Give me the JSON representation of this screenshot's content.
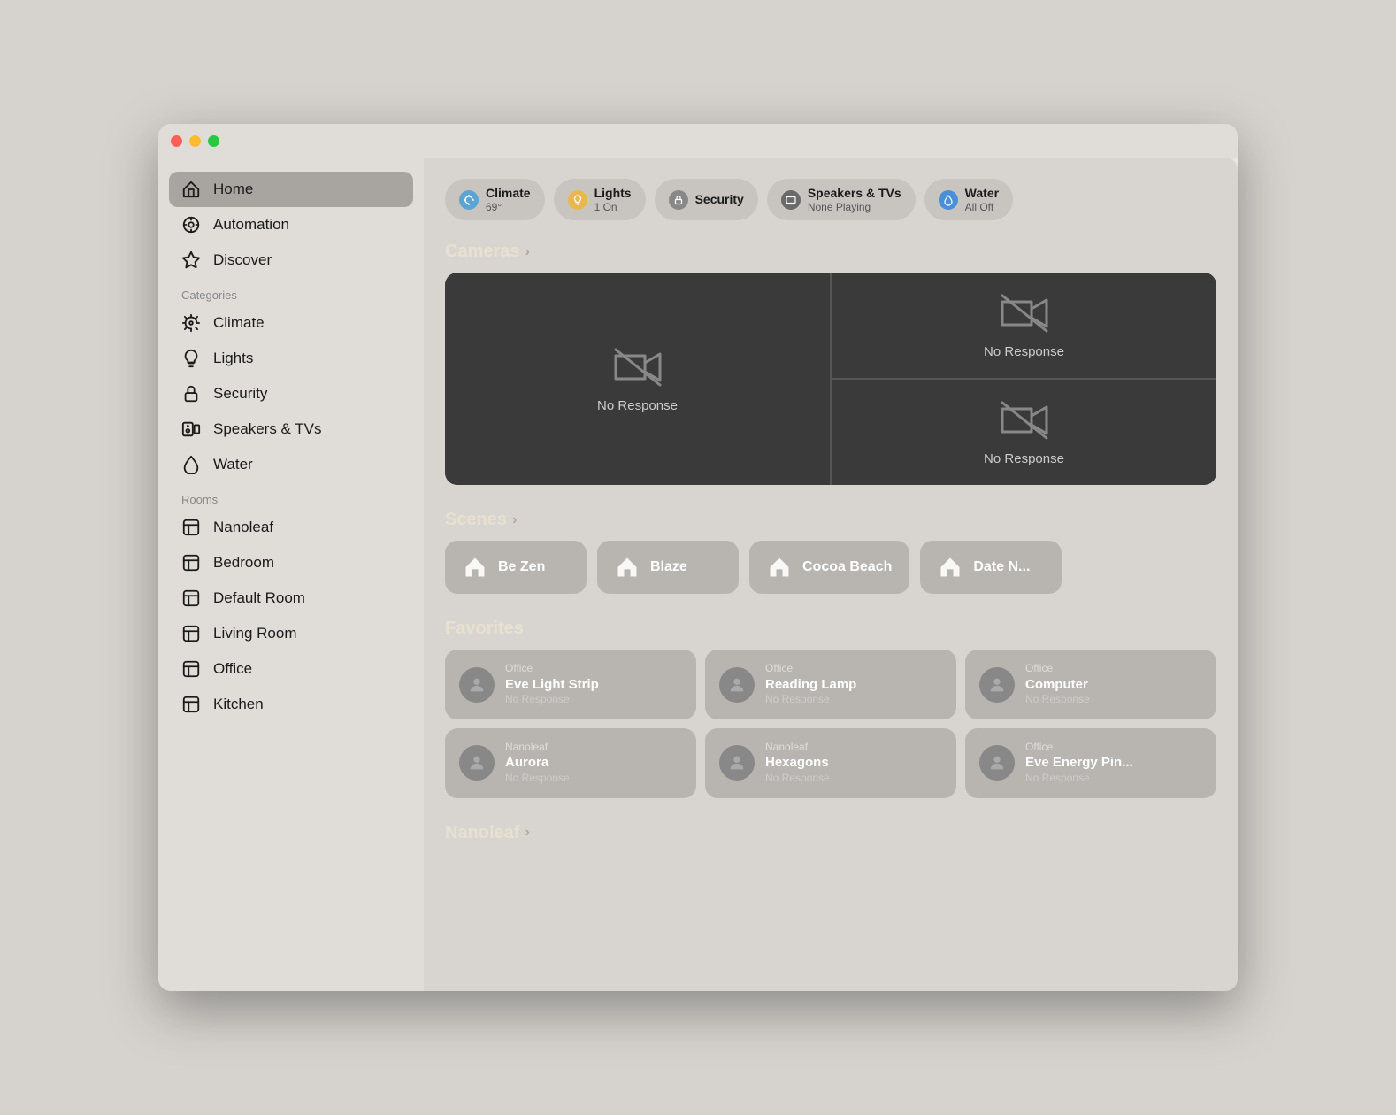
{
  "titlebar": {
    "buttons": [
      "close",
      "minimize",
      "maximize"
    ]
  },
  "sidebar": {
    "nav": [
      {
        "id": "home",
        "label": "Home",
        "icon": "home",
        "active": true
      },
      {
        "id": "automation",
        "label": "Automation",
        "icon": "automation",
        "active": false
      },
      {
        "id": "discover",
        "label": "Discover",
        "icon": "discover",
        "active": false
      }
    ],
    "categories_label": "Categories",
    "categories": [
      {
        "id": "climate",
        "label": "Climate",
        "icon": "climate"
      },
      {
        "id": "lights",
        "label": "Lights",
        "icon": "lights"
      },
      {
        "id": "security",
        "label": "Security",
        "icon": "security"
      },
      {
        "id": "speakers_tvs",
        "label": "Speakers & TVs",
        "icon": "speakers"
      },
      {
        "id": "water",
        "label": "Water",
        "icon": "water"
      }
    ],
    "rooms_label": "Rooms",
    "rooms": [
      {
        "id": "nanoleaf",
        "label": "Nanoleaf",
        "icon": "room"
      },
      {
        "id": "bedroom",
        "label": "Bedroom",
        "icon": "room"
      },
      {
        "id": "default_room",
        "label": "Default Room",
        "icon": "room"
      },
      {
        "id": "living_room",
        "label": "Living Room",
        "icon": "room"
      },
      {
        "id": "office",
        "label": "Office",
        "icon": "room"
      },
      {
        "id": "kitchen",
        "label": "Kitchen",
        "icon": "room"
      }
    ]
  },
  "tabs": [
    {
      "id": "climate",
      "icon_type": "blue",
      "label": "Climate",
      "sublabel": "69°"
    },
    {
      "id": "lights",
      "icon_type": "yellow",
      "label": "Lights",
      "sublabel": "1 On"
    },
    {
      "id": "security",
      "icon_type": "gray",
      "label": "Security",
      "sublabel": ""
    },
    {
      "id": "speakers_tvs",
      "icon_type": "tv",
      "label": "Speakers & TVs",
      "sublabel": "None Playing"
    },
    {
      "id": "water",
      "icon_type": "water-blue",
      "label": "Water",
      "sublabel": "All Off"
    }
  ],
  "cameras": {
    "section_label": "Cameras",
    "cells": [
      {
        "id": "cam1",
        "status": "No Response"
      },
      {
        "id": "cam2",
        "status": "No Response"
      },
      {
        "id": "cam3",
        "status": "No Response"
      }
    ]
  },
  "scenes": {
    "section_label": "Scenes",
    "items": [
      {
        "id": "be_zen",
        "label": "Be Zen"
      },
      {
        "id": "blaze",
        "label": "Blaze"
      },
      {
        "id": "cocoa_beach",
        "label": "Cocoa Beach"
      },
      {
        "id": "date_night",
        "label": "Date N..."
      }
    ]
  },
  "favorites": {
    "section_label": "Favorites",
    "items": [
      {
        "id": "fav1",
        "room": "Office",
        "name": "Eve Light Strip",
        "status": "No Response"
      },
      {
        "id": "fav2",
        "room": "Office",
        "name": "Reading Lamp",
        "status": "No Response"
      },
      {
        "id": "fav3",
        "room": "Office",
        "name": "Computer",
        "status": "No Response"
      },
      {
        "id": "fav4",
        "room": "Nanoleaf",
        "name": "Aurora",
        "status": "No Response"
      },
      {
        "id": "fav5",
        "room": "Nanoleaf",
        "name": "Hexagons",
        "status": "No Response"
      },
      {
        "id": "fav6",
        "room": "Office",
        "name": "Eve Energy Pin...",
        "status": "No Response"
      }
    ]
  },
  "nanoleaf": {
    "section_label": "Nanoleaf"
  }
}
